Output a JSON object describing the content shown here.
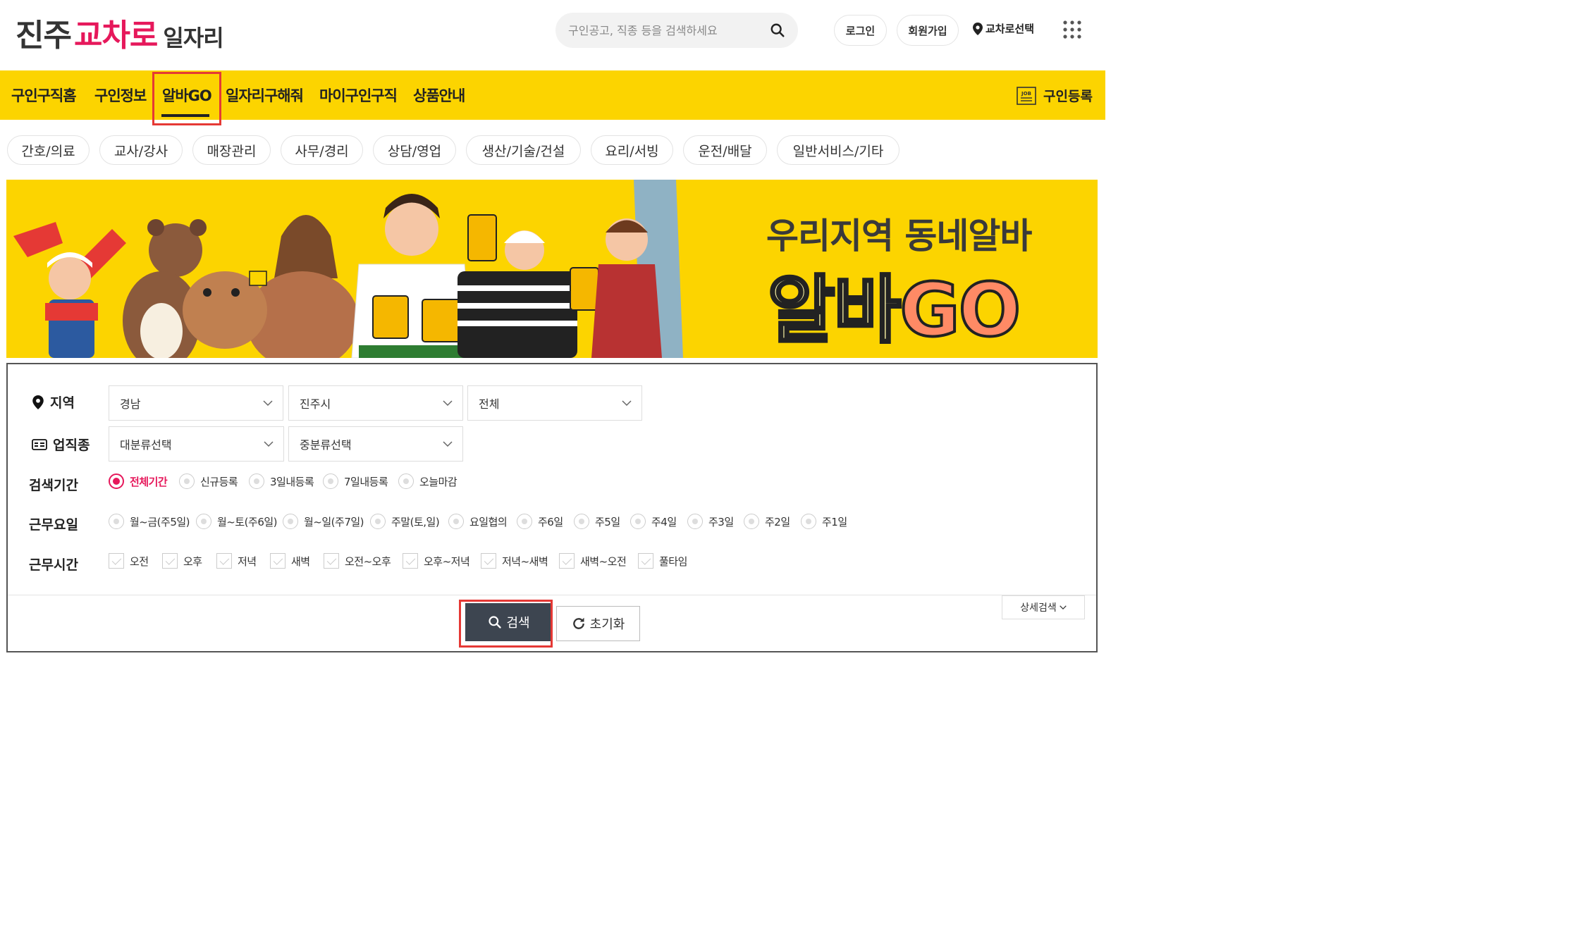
{
  "logo": {
    "part1": "진주",
    "part2": "교차로",
    "part3": "일자리"
  },
  "header": {
    "search_placeholder": "구인공고, 직종 등을 검색하세요",
    "login": "로그인",
    "signup": "회원가입",
    "location": "교차로선택"
  },
  "nav": {
    "items": [
      "구인구직홈",
      "구인정보",
      "알바GO",
      "일자리구해줘",
      "마이구인구직",
      "상품안내"
    ],
    "active": "알바GO",
    "register": "구인등록",
    "register_icon_text": "JOB"
  },
  "categories": [
    "간호/의료",
    "교사/강사",
    "매장관리",
    "사무/경리",
    "상담/영업",
    "생산/기술/건설",
    "요리/서빙",
    "운전/배달",
    "일반서비스/기타"
  ],
  "banner": {
    "line1": "우리지역 동네알바",
    "line2a": "알바",
    "line2b": "GO"
  },
  "form": {
    "region_label": "지역",
    "region_values": [
      "경남",
      "진주시",
      "전체"
    ],
    "job_label": "업직종",
    "job_values": [
      "대분류선택",
      "중분류선택"
    ],
    "period_label": "검색기간",
    "period_options": [
      "전체기간",
      "신규등록",
      "3일내등록",
      "7일내등록",
      "오늘마감"
    ],
    "period_selected": "전체기간",
    "days_label": "근무요일",
    "days_options": [
      "월~금(주5일)",
      "월~토(주6일)",
      "월~일(주7일)",
      "주말(토,일)",
      "요일협의",
      "주6일",
      "주5일",
      "주4일",
      "주3일",
      "주2일",
      "주1일"
    ],
    "time_label": "근무시간",
    "time_options": [
      "오전",
      "오후",
      "저녁",
      "새벽",
      "오전~오후",
      "오후~저녁",
      "저녁~새벽",
      "새벽~오전",
      "풀타임"
    ],
    "search_button": "검색",
    "reset_button": "초기화",
    "detail_button": "상세검색"
  },
  "colors": {
    "brand_pink": "#e6185b",
    "nav_yellow": "#fcd400",
    "highlight_red": "#e53935"
  }
}
